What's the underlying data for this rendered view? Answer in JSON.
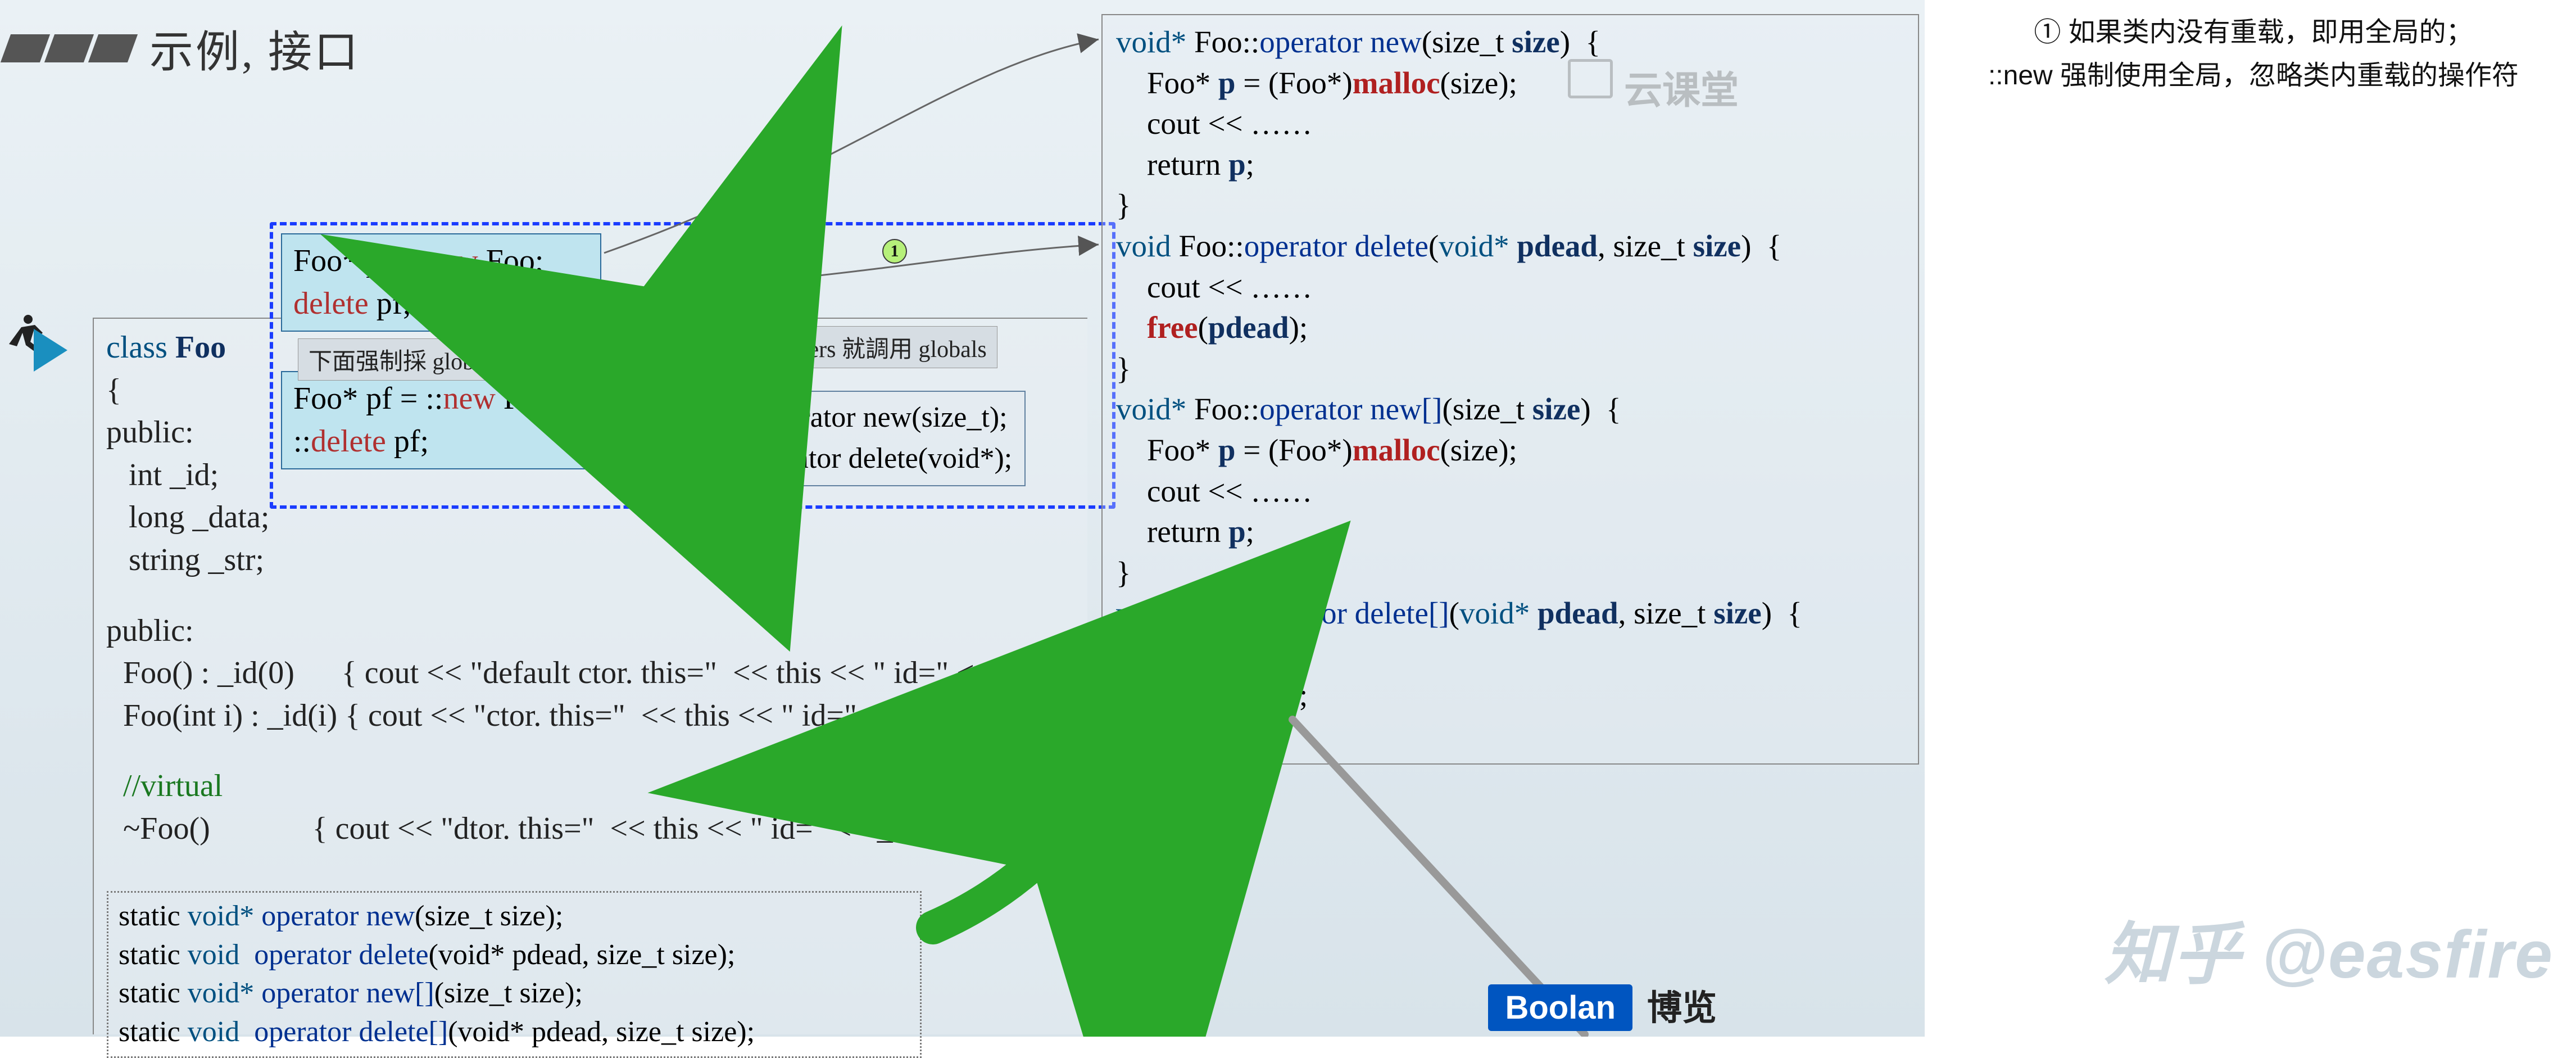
{
  "title": "示例, 接口",
  "annotation": {
    "line1": "① 如果类内没有重载，即用全局的；",
    "line2": "::new 强制使用全局，忽略类内重载的操作符"
  },
  "labels": {
    "forced_global": "下面强制採 globals",
    "fallback_global": "若無 members 就調用 globals"
  },
  "class_foo": {
    "decl_open": "class Foo",
    "brace": "{",
    "public1": "public:",
    "m_id": "int _id;",
    "m_data": "long _data;",
    "m_str": "string _str;",
    "public2": "public:",
    "ctor0": "Foo() : _id(0)      { cout << \"default ctor. this=\"  << this << \" id=\" <<",
    "ctor1": "Foo(int i) : _id(i) { cout << \"ctor. this=\"  << this << \" id=\" << _id <<",
    "virtual_cm": "//virtual",
    "dtor": "~Foo()               { cout << \"dtor. this=\"  << this << \" id=\" << _id << endl; }",
    "s_new": "static void* operator new(size_t size);",
    "s_del": "static void  operator delete(void* pdead, size_t size);",
    "s_newa": "static void* operator new[](size_t size);",
    "s_dela": "static void  operator delete[](void* pdead, size_t size);"
  },
  "blue_top": {
    "l1": "Foo* pf = new Foo;",
    "l2": "delete pf;"
  },
  "blue_bot": {
    "l1": "Foo* pf = ::new Foo;",
    "l2": "::delete pf;"
  },
  "global_ops": {
    "l1": "void* ::operator new(size_t);",
    "l2": "void  ::operator delete(void*);"
  },
  "impl": {
    "new_sig": "void* Foo::operator new(size_t size)  {",
    "new_b1": "Foo* p = (Foo*)malloc(size);",
    "new_b2": "cout << ……",
    "new_b3": "return p;",
    "del_sig": "void Foo::operator delete(void* pdead, size_t size)  {",
    "del_b1": "cout << ……",
    "del_b2": "free(pdead);",
    "newa_sig": "void* Foo::operator new[](size_t size)  {",
    "dela_sig": "void Foo::operator delete[](void* pdead, size_t size)  {"
  },
  "circle_num": "1",
  "boolan": "Boolan",
  "bolan_cn": "博览",
  "wm_cloud": "云课堂",
  "zhihu_wm": "知乎 @easfire"
}
